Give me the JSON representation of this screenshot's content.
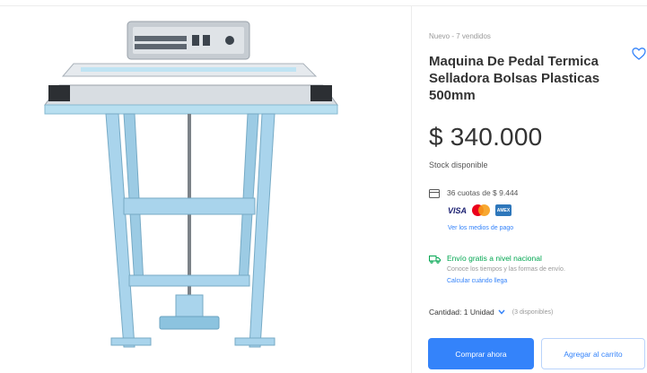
{
  "product": {
    "condition": "Nuevo - 7 vendidos",
    "title": "Maquina De Pedal Termica Selladora Bolsas Plasticas 500mm",
    "price": "$ 340.000",
    "stock": "Stock disponible",
    "image_icon": "heat-sealer-machine"
  },
  "payment": {
    "installments": "36 cuotas de $ 9.444",
    "logos": [
      "VISA",
      "mastercard",
      "AMEX"
    ],
    "more_link": "Ver los medios de pago"
  },
  "shipping": {
    "title": "Envío gratis a nivel nacional",
    "description": "Conoce los tiempos y las formas de envío.",
    "link": "Calcular cuándo llega"
  },
  "quantity": {
    "label": "Cantidad: 1 Unidad",
    "available": "(3 disponibles)"
  },
  "actions": {
    "buy": "Comprar ahora",
    "cart": "Agregar al carrito"
  },
  "colors": {
    "accent": "#3483fa",
    "shipping_green": "#00a650",
    "machine_blue": "#a9d4ec"
  }
}
